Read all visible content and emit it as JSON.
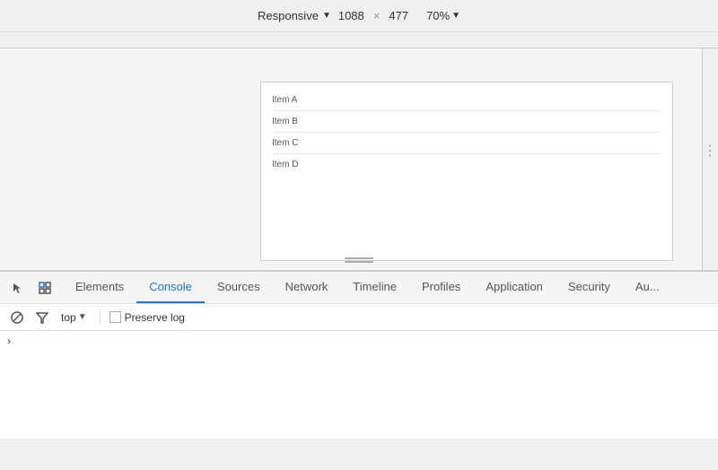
{
  "topbar": {
    "responsive_label": "Responsive",
    "width": "1088",
    "separator": "×",
    "height": "477",
    "zoom": "70%"
  },
  "preview": {
    "items": [
      {
        "label": "Item A"
      },
      {
        "label": "Item B"
      },
      {
        "label": "Item C"
      },
      {
        "label": "Item D"
      }
    ]
  },
  "devtools": {
    "tabs": [
      {
        "id": "elements",
        "label": "Elements",
        "active": false
      },
      {
        "id": "console",
        "label": "Console",
        "active": true
      },
      {
        "id": "sources",
        "label": "Sources",
        "active": false
      },
      {
        "id": "network",
        "label": "Network",
        "active": false
      },
      {
        "id": "timeline",
        "label": "Timeline",
        "active": false
      },
      {
        "id": "profiles",
        "label": "Profiles",
        "active": false
      },
      {
        "id": "application",
        "label": "Application",
        "active": false
      },
      {
        "id": "security",
        "label": "Security",
        "active": false
      },
      {
        "id": "audits",
        "label": "Au...",
        "active": false
      }
    ],
    "toolbar": {
      "context_label": "top",
      "preserve_log_label": "Preserve log"
    }
  }
}
